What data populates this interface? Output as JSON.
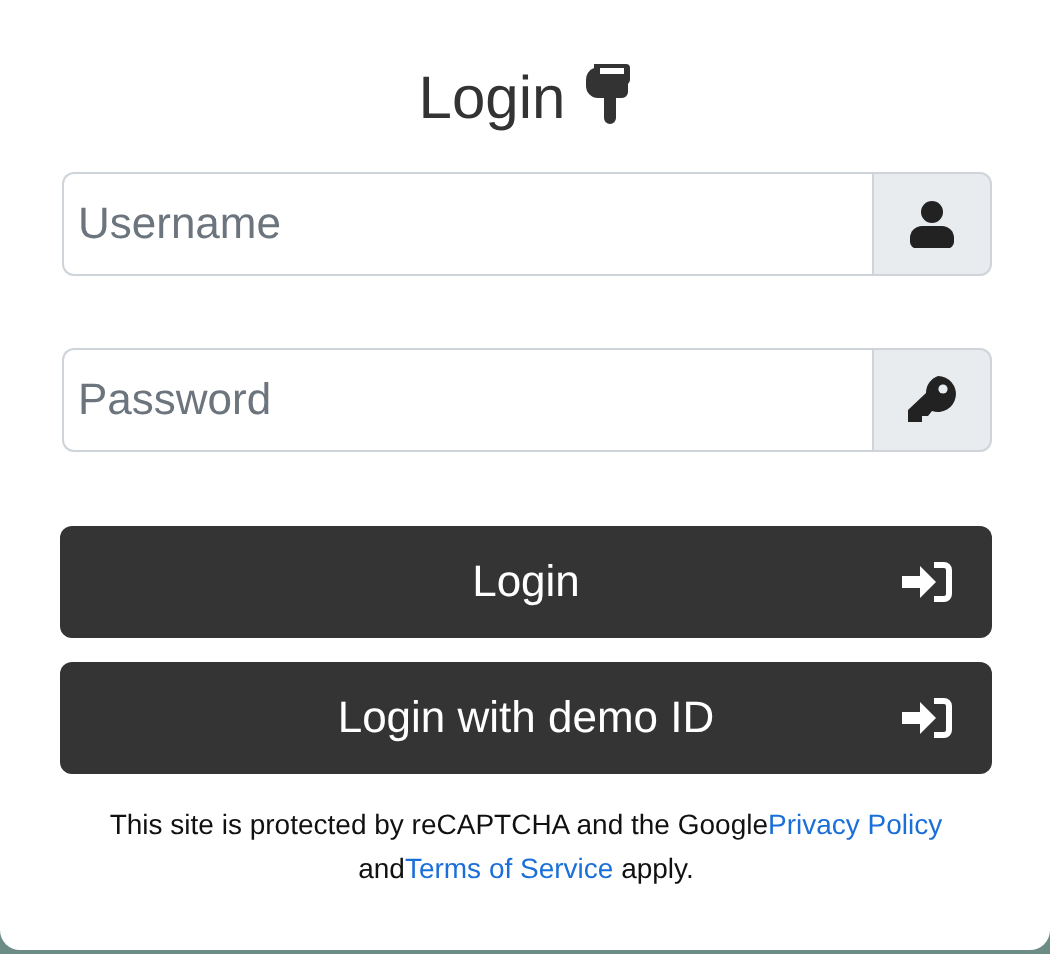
{
  "title": "Login",
  "fields": [
    {
      "kind": "username",
      "placeholder": "Username"
    },
    {
      "kind": "password",
      "placeholder": "Password"
    }
  ],
  "buttons": [
    {
      "label": "Login"
    },
    {
      "label": "Login with demo ID"
    }
  ],
  "notice": {
    "before": "This site is protected by reCAPTCHA and the Google",
    "link_1": "Privacy Policy",
    "middle": " and",
    "link_2": "Terms of Service",
    "after": " apply."
  }
}
